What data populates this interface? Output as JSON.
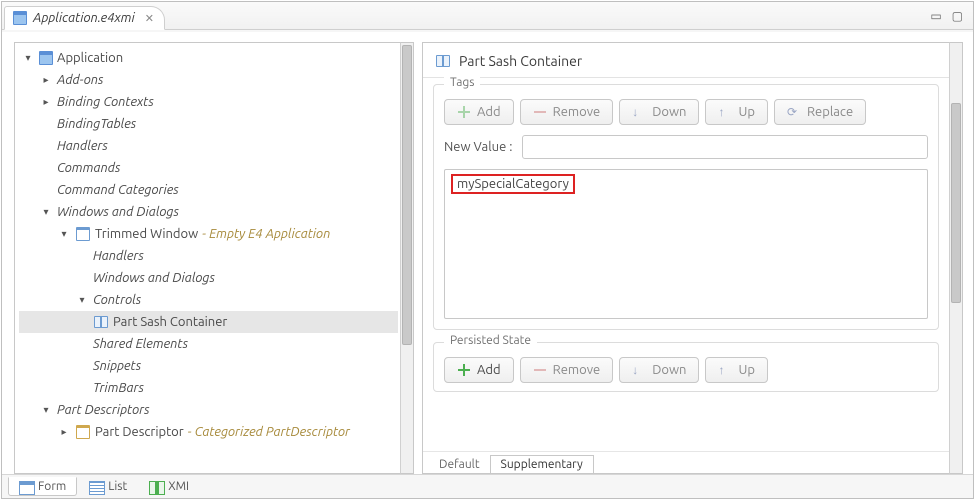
{
  "tab": {
    "title": "Application.e4xmi"
  },
  "tree": {
    "root": {
      "label": "Application"
    },
    "items": [
      "Add-ons",
      "Binding Contexts",
      "BindingTables",
      "Handlers",
      "Commands",
      "Command Categories",
      "Windows and Dialogs"
    ],
    "trimmed": {
      "label": "Trimmed Window",
      "suffix": " - Empty E4 Application"
    },
    "trimmedChildren": [
      "Handlers",
      "Windows and Dialogs",
      "Controls"
    ],
    "selected": "Part Sash Container",
    "afterSelected": [
      "Shared Elements",
      "Snippets",
      "TrimBars"
    ],
    "partDescriptors": "Part Descriptors",
    "partDescriptor": {
      "label": "Part Descriptor",
      "suffix": " - Categorized PartDescriptor"
    }
  },
  "detail": {
    "title": "Part Sash Container",
    "tags": {
      "legend": "Tags",
      "buttons": {
        "add": "Add",
        "remove": "Remove",
        "down": "Down",
        "up": "Up",
        "replace": "Replace"
      },
      "newValueLabel": "New Value :",
      "newValue": "",
      "item": "mySpecialCategory"
    },
    "persisted": {
      "legend": "Persisted State",
      "buttons": {
        "add": "Add",
        "remove": "Remove",
        "down": "Down",
        "up": "Up"
      }
    },
    "tabs": {
      "default": "Default",
      "supplementary": "Supplementary"
    }
  },
  "footer": {
    "form": "Form",
    "list": "List",
    "xmi": "XMI"
  }
}
